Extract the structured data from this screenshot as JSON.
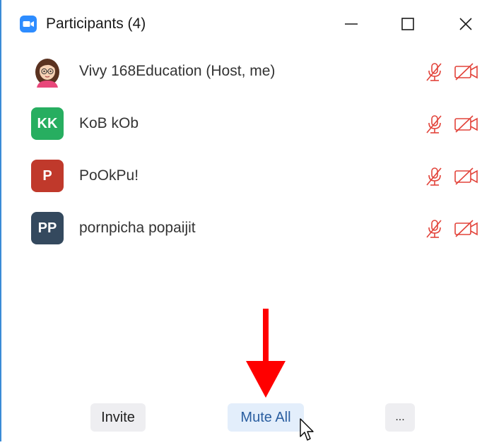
{
  "window": {
    "title": "Participants (4)",
    "accent_color": "#2d8cff"
  },
  "participants": [
    {
      "name": "Vivy 168Education (Host, me)",
      "avatar": "photo",
      "initials": "",
      "avatar_color": "#ffffff",
      "mic": "muted",
      "video": "off"
    },
    {
      "name": "KoB kOb",
      "avatar": "initials",
      "initials": "KK",
      "avatar_color": "#27ae60",
      "mic": "muted",
      "video": "off"
    },
    {
      "name": "PoOkPu!",
      "avatar": "initials",
      "initials": "P",
      "avatar_color": "#c0392b",
      "mic": "muted",
      "video": "off"
    },
    {
      "name": "pornpicha popaijit",
      "avatar": "initials",
      "initials": "PP",
      "avatar_color": "#34495e",
      "mic": "muted",
      "video": "off"
    }
  ],
  "status_icon_color": "#e2433a",
  "footer": {
    "invite_label": "Invite",
    "mute_all_label": "Mute All",
    "more_label": "..."
  },
  "annotation": {
    "arrow_color": "#ff0000"
  }
}
